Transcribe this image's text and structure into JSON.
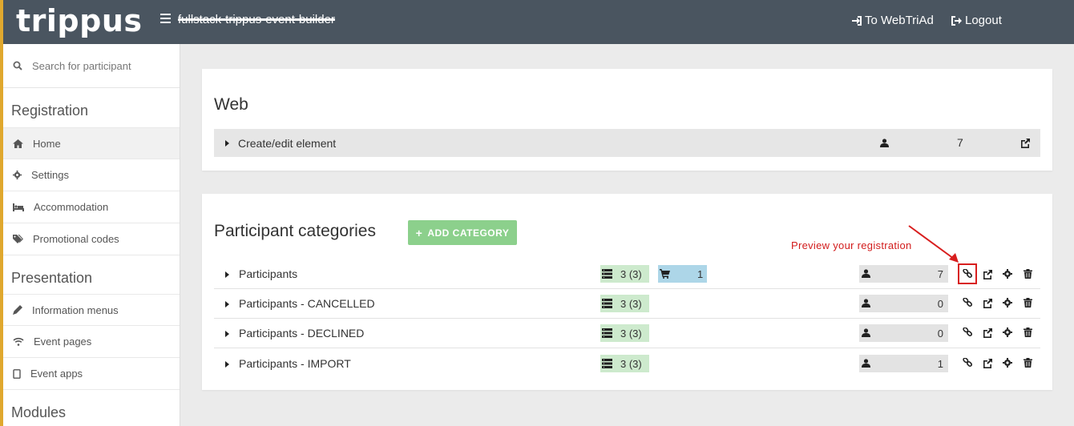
{
  "header": {
    "logo": "trippus",
    "account": "fullstack-trippus-event-builder",
    "to_webtriad": "To WebTriAd",
    "logout": "Logout"
  },
  "sidebar": {
    "search_placeholder": "Search for participant",
    "sections": [
      {
        "title": "Registration",
        "items": [
          {
            "label": "Home",
            "icon": "home-icon"
          },
          {
            "label": "Settings",
            "icon": "gear-icon"
          },
          {
            "label": "Accommodation",
            "icon": "bed-icon"
          },
          {
            "label": "Promotional codes",
            "icon": "tags-icon"
          }
        ]
      },
      {
        "title": "Presentation",
        "items": [
          {
            "label": "Information menus",
            "icon": "pencil-icon"
          },
          {
            "label": "Event pages",
            "icon": "wifi-icon"
          },
          {
            "label": "Event apps",
            "icon": "tablet-icon"
          }
        ]
      },
      {
        "title": "Modules"
      }
    ]
  },
  "web_panel": {
    "title": "Web",
    "row": {
      "label": "Create/edit element",
      "count": "7"
    }
  },
  "categories_panel": {
    "title": "Participant categories",
    "add_button": "ADD CATEGORY",
    "preview_note": "Preview your registration",
    "rows": [
      {
        "name": "Participants",
        "form": "3 (3)",
        "cart": "1",
        "participants": "7"
      },
      {
        "name": "Participants - CANCELLED",
        "form": "3 (3)",
        "participants": "0"
      },
      {
        "name": "Participants - DECLINED",
        "form": "3 (3)",
        "participants": "0"
      },
      {
        "name": "Participants - IMPORT",
        "form": "3 (3)",
        "participants": "1"
      }
    ]
  },
  "colors": {
    "topbar": "#4a5560",
    "accent": "#e0a82e",
    "add_button": "#8cd08c",
    "badge_form": "#cdeacd",
    "badge_cart": "#add6e8",
    "highlight": "#d81e1e"
  }
}
